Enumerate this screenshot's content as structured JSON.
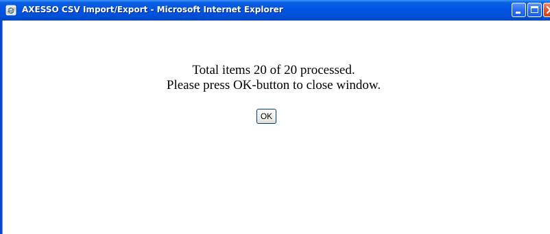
{
  "window": {
    "title": "AXESSO CSV Import/Export - Microsoft Internet Explorer",
    "icon": "internet-explorer-icon",
    "controls": {
      "minimize_icon": "minimize-icon",
      "maximize_icon": "maximize-icon",
      "close_icon": "close-icon"
    }
  },
  "content": {
    "message_line1": "Total items 20 of 20 processed.",
    "message_line2": "Please press OK-button to close window.",
    "ok_button_label": "OK"
  },
  "colors": {
    "titlebar": "#0054e3",
    "title_text": "#ffffff",
    "close_button": "#e0542c",
    "background": "#ffffff"
  }
}
